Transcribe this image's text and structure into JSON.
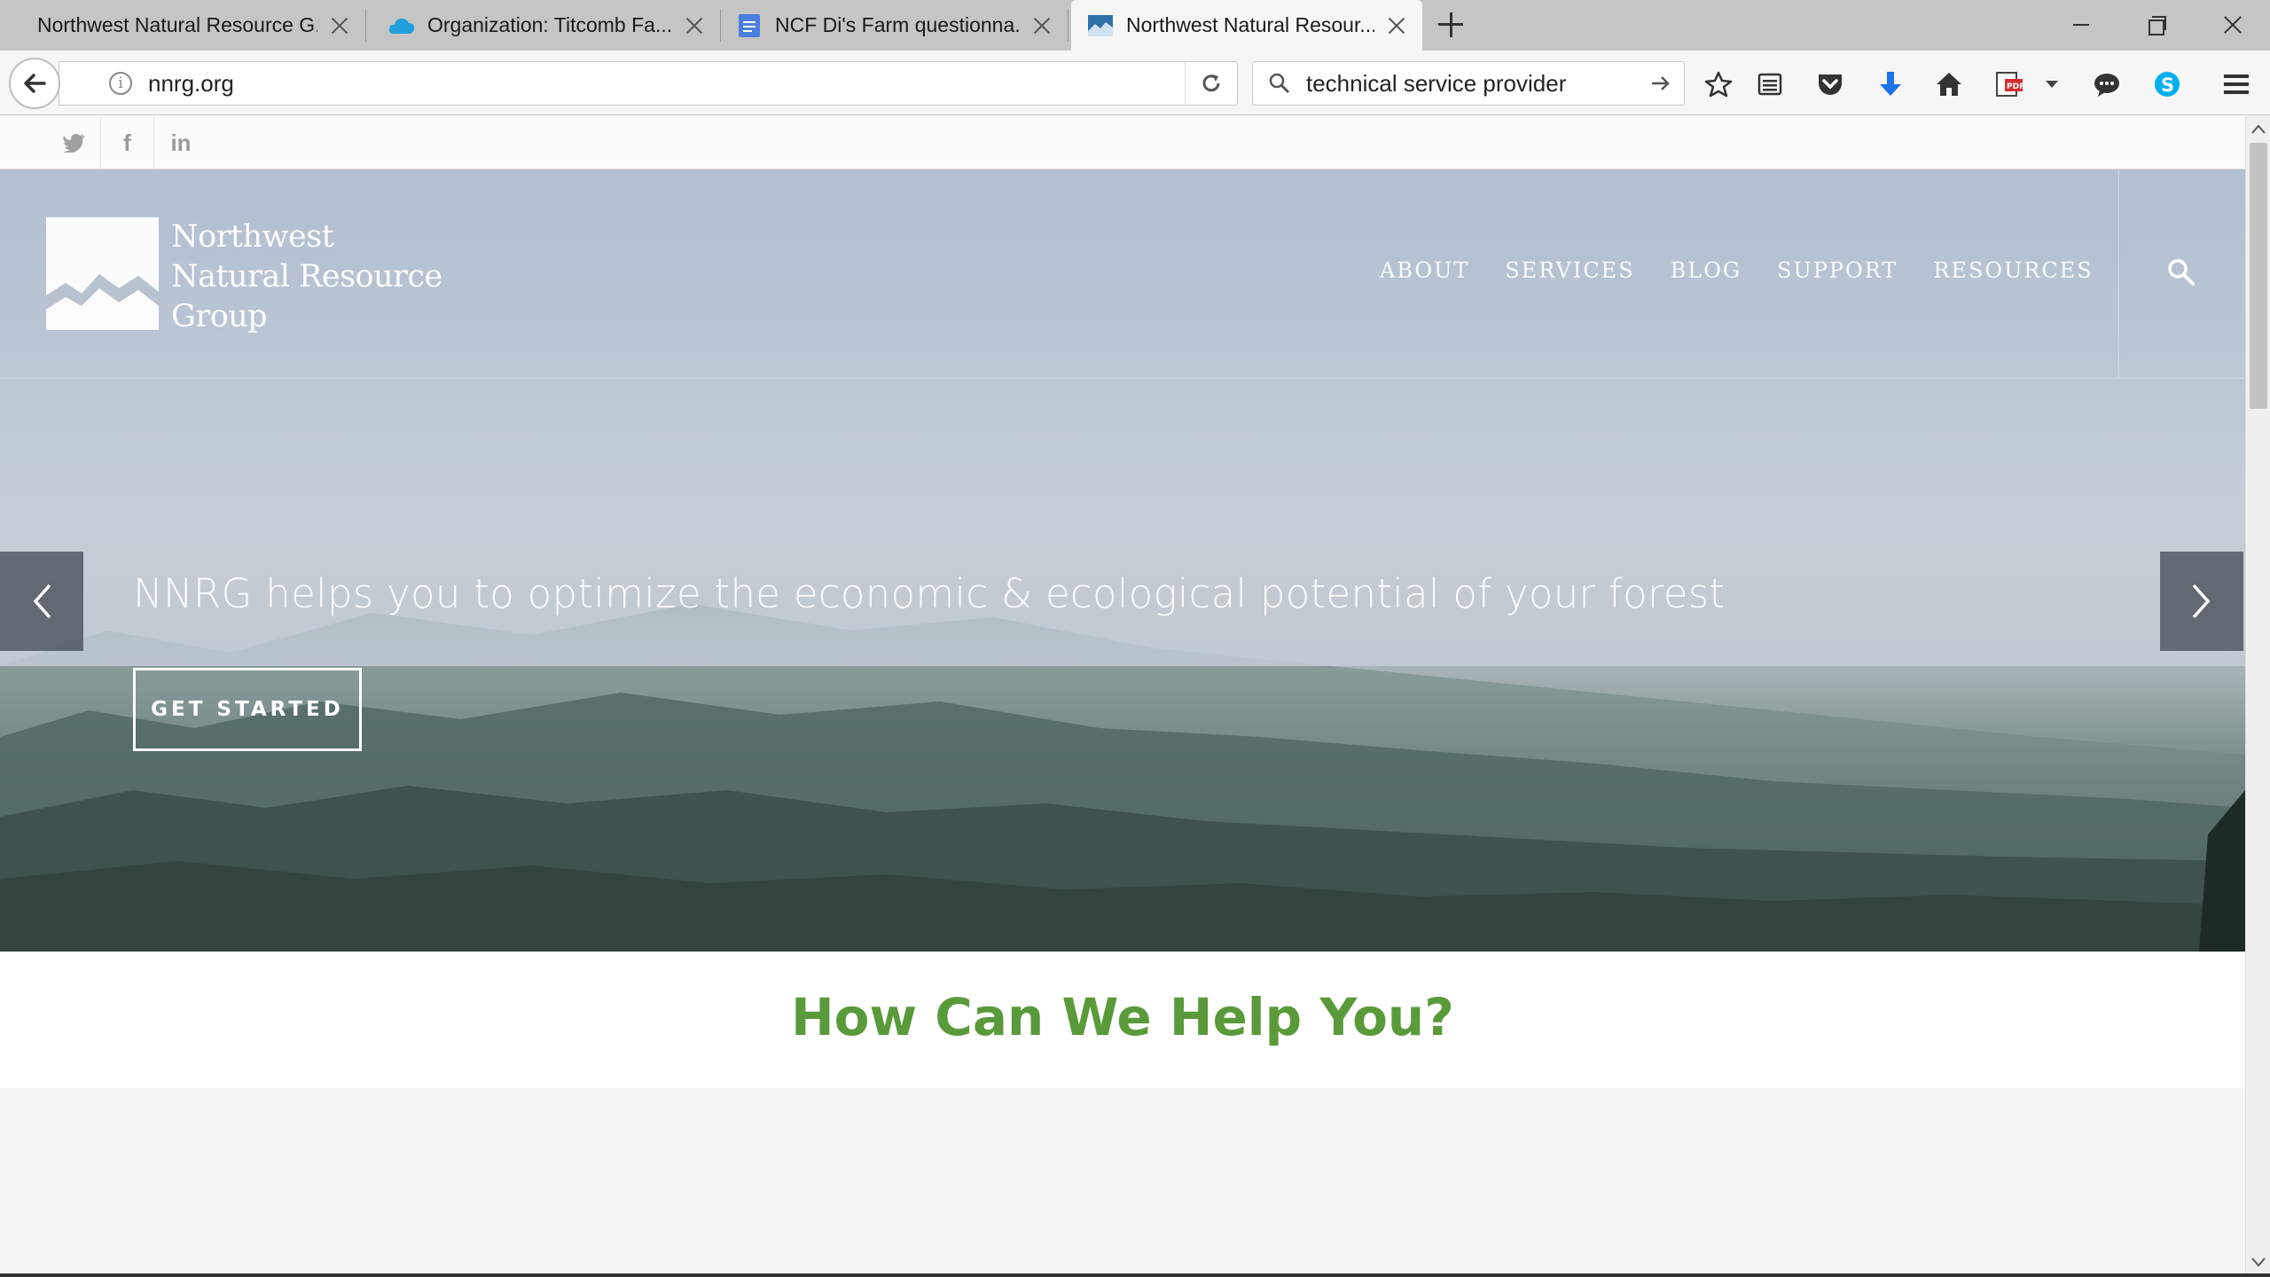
{
  "browser": {
    "tabs": [
      {
        "title": "Northwest Natural Resource G...",
        "favicon": "none",
        "active": false
      },
      {
        "title": "Organization: Titcomb Fa...",
        "favicon": "salesforce-cloud-icon",
        "active": false
      },
      {
        "title": "NCF Di's Farm questionna...",
        "favicon": "google-docs-icon",
        "active": false
      },
      {
        "title": "Northwest Natural Resour...",
        "favicon": "nnrg-icon",
        "active": true
      }
    ],
    "url": "nnrg.org",
    "search_query": "technical service provider",
    "toolbar_icons": [
      "star-icon",
      "reading-list-icon",
      "pocket-icon",
      "download-icon",
      "home-icon",
      "pdf-icon",
      "chat-icon",
      "skype-icon",
      "menu-icon"
    ]
  },
  "site": {
    "social": [
      {
        "name": "twitter",
        "glyph": "🐦"
      },
      {
        "name": "facebook",
        "glyph": "f"
      },
      {
        "name": "linkedin",
        "glyph": "in"
      }
    ],
    "logo_lines": [
      "Northwest",
      "Natural Resource",
      "Group"
    ],
    "nav": [
      "ABOUT",
      "SERVICES",
      "BLOG",
      "SUPPORT",
      "RESOURCES"
    ],
    "hero": {
      "tagline": "NNRG helps you to optimize the economic & ecological potential of your forest",
      "cta": "GET STARTED"
    },
    "help_title": "How Can We Help You?",
    "colors": {
      "accent_green": "#5a9a3a",
      "tab_strip": "#c5c5c5",
      "download_blue": "#1a73e8",
      "skype_blue": "#00aff0"
    }
  }
}
